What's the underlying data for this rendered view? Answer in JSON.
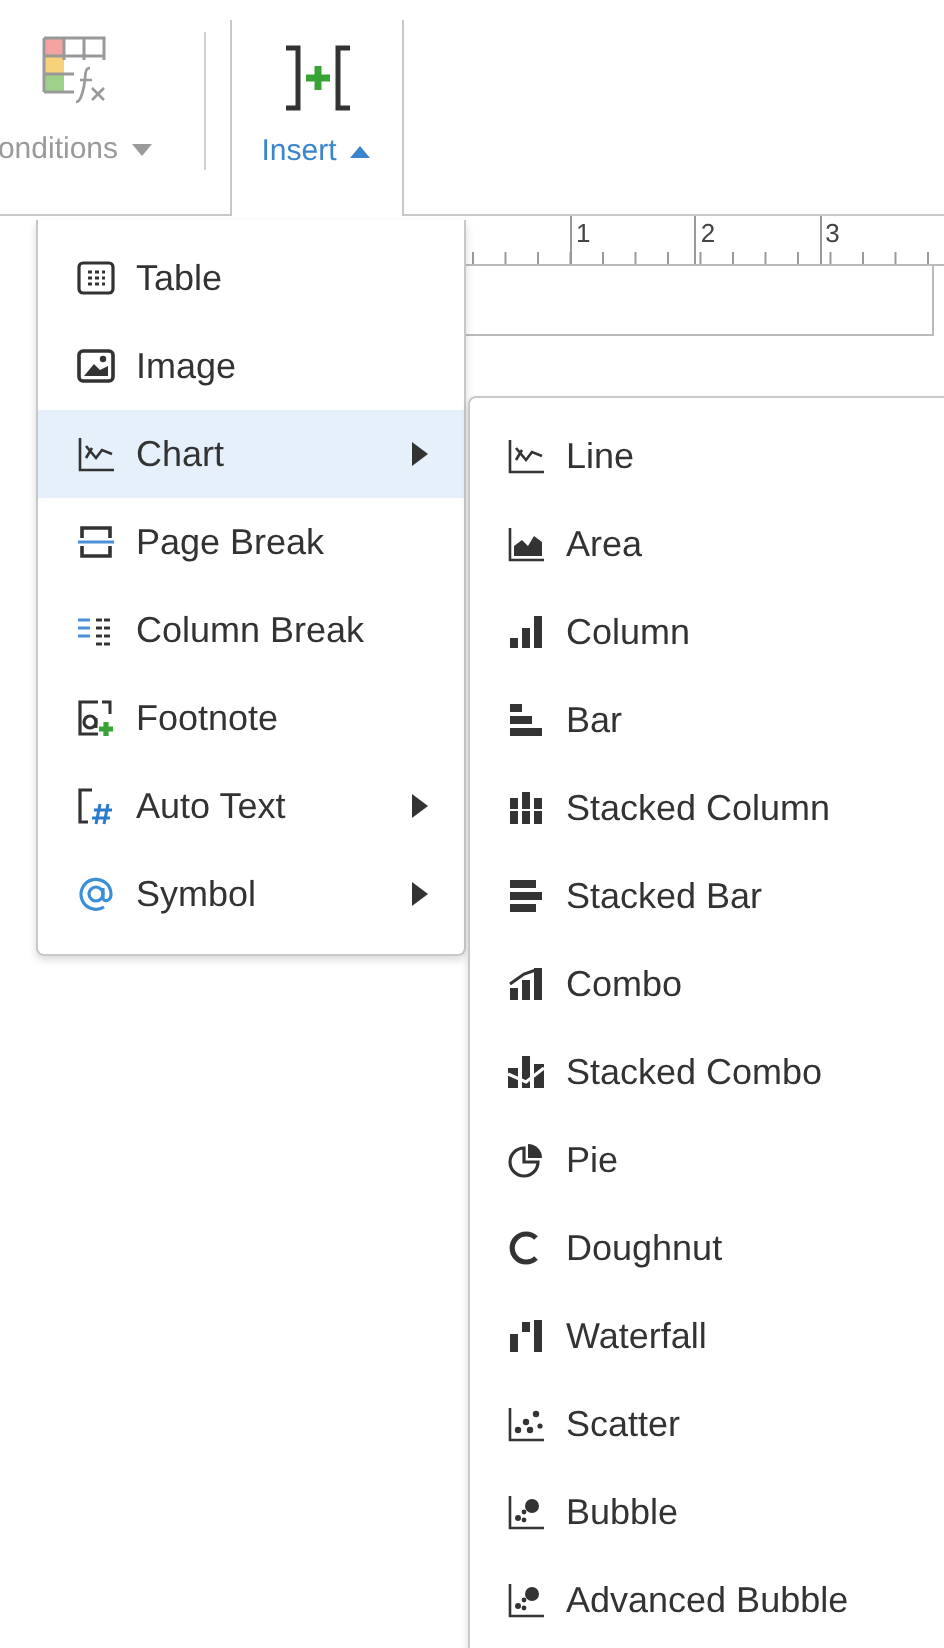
{
  "toolbar": {
    "items": [
      {
        "label": "onditions",
        "disabled": true,
        "expanded": false
      },
      {
        "label": "Insert",
        "disabled": false,
        "expanded": true
      }
    ]
  },
  "ruler": {
    "labels": [
      "1",
      "2",
      "3"
    ]
  },
  "insert_menu": {
    "items": [
      {
        "label": "Table",
        "selected": false,
        "submenu": false
      },
      {
        "label": "Image",
        "selected": false,
        "submenu": false
      },
      {
        "label": "Chart",
        "selected": true,
        "submenu": true
      },
      {
        "label": "Page Break",
        "selected": false,
        "submenu": false
      },
      {
        "label": "Column Break",
        "selected": false,
        "submenu": false
      },
      {
        "label": "Footnote",
        "selected": false,
        "submenu": false
      },
      {
        "label": "Auto Text",
        "selected": false,
        "submenu": true
      },
      {
        "label": "Symbol",
        "selected": false,
        "submenu": true
      }
    ]
  },
  "chart_submenu": {
    "items": [
      {
        "label": "Line"
      },
      {
        "label": "Area"
      },
      {
        "label": "Column"
      },
      {
        "label": "Bar"
      },
      {
        "label": "Stacked Column"
      },
      {
        "label": "Stacked Bar"
      },
      {
        "label": "Combo"
      },
      {
        "label": "Stacked Combo"
      },
      {
        "label": "Pie"
      },
      {
        "label": "Doughnut"
      },
      {
        "label": "Waterfall"
      },
      {
        "label": "Scatter"
      },
      {
        "label": "Bubble"
      },
      {
        "label": "Advanced Bubble"
      }
    ]
  }
}
